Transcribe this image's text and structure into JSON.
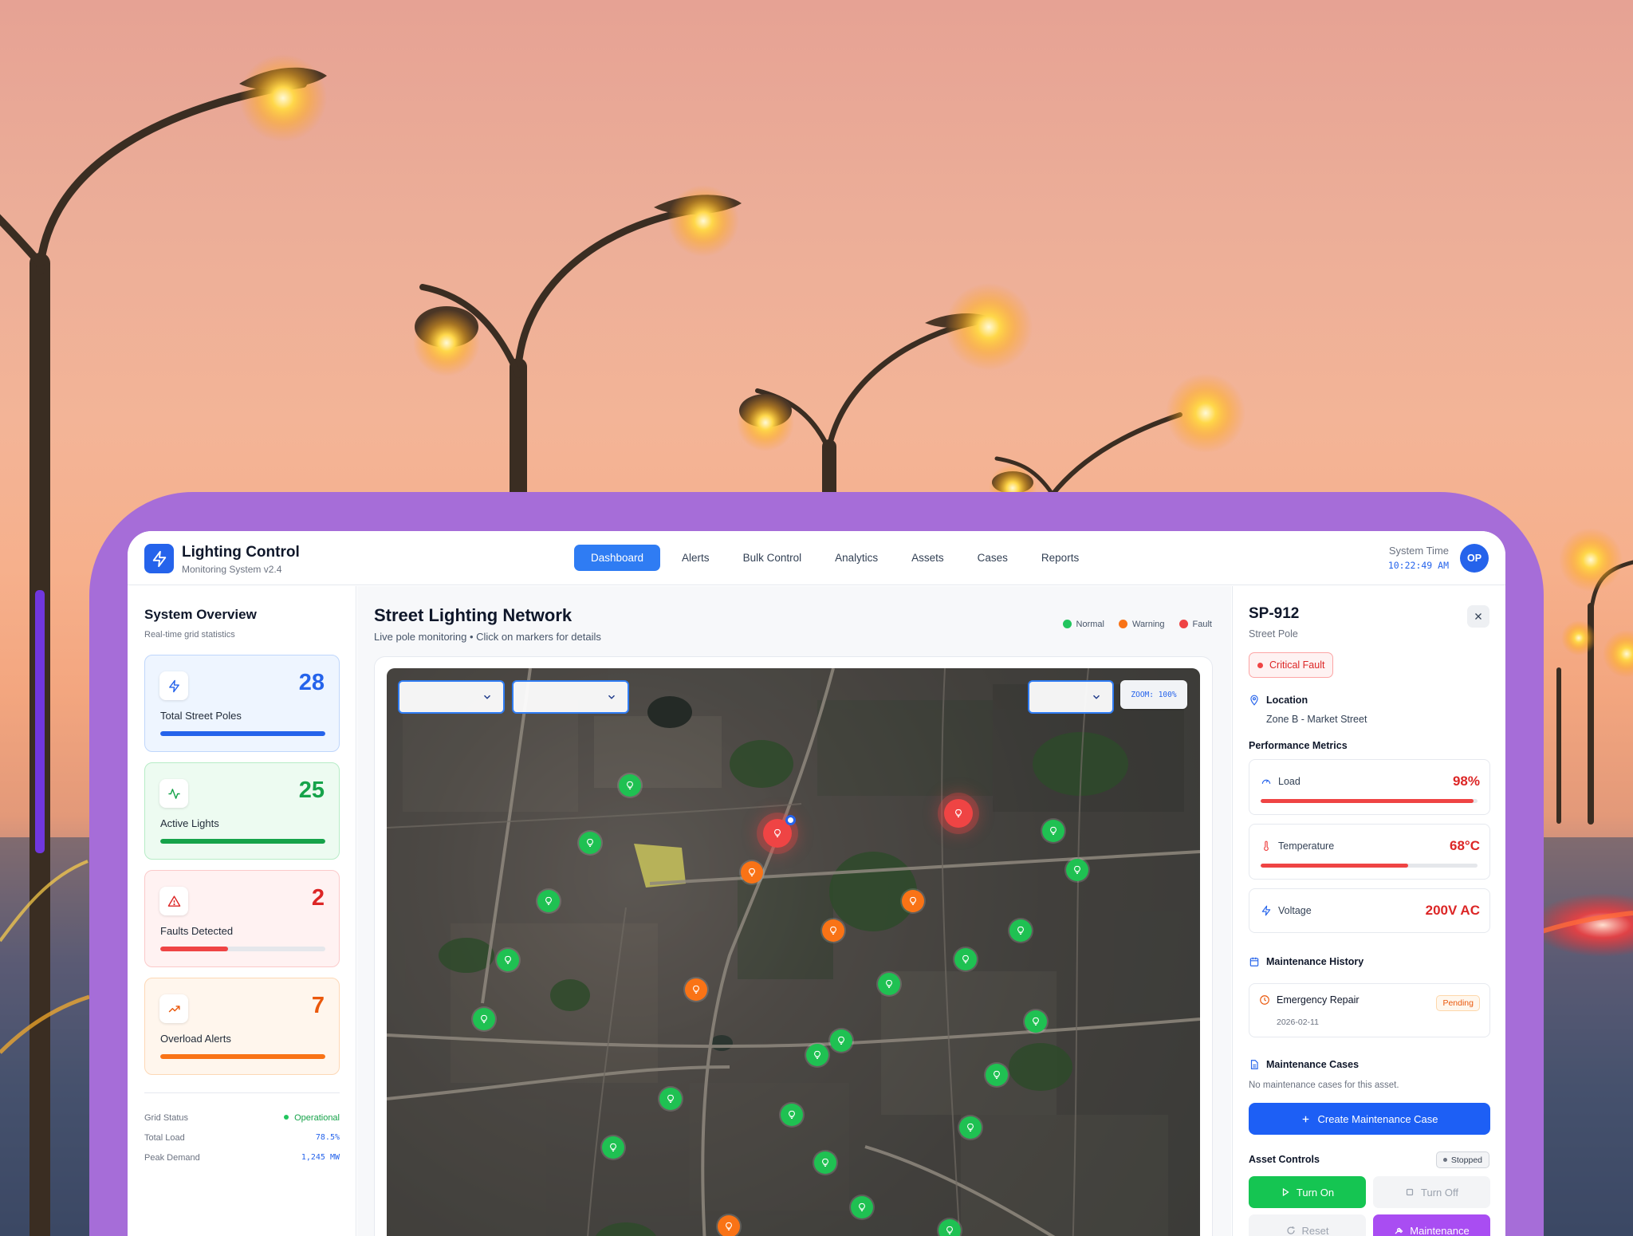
{
  "header": {
    "app_title": "Lighting Control",
    "app_subtitle": "Monitoring System v2.4",
    "nav": [
      "Dashboard",
      "Alerts",
      "Bulk Control",
      "Analytics",
      "Assets",
      "Cases",
      "Reports"
    ],
    "active_nav": "Dashboard",
    "system_time_label": "System Time",
    "system_time": "10:22:49 AM",
    "avatar_initials": "OP"
  },
  "overview": {
    "title": "System Overview",
    "subtitle": "Real-time grid statistics",
    "stats": [
      {
        "label": "Total Street Poles",
        "value": "28",
        "fill": 1.0,
        "color": "#2563eb",
        "icon": "zap-icon"
      },
      {
        "label": "Active Lights",
        "value": "25",
        "fill": 1.0,
        "color": "#16a34a",
        "icon": "activity-icon"
      },
      {
        "label": "Faults Detected",
        "value": "2",
        "fill": 0.31,
        "color": "#dc2626",
        "icon": "alert-triangle-icon"
      },
      {
        "label": "Overload Alerts",
        "value": "7",
        "fill": 1.0,
        "color": "#ea580c",
        "icon": "trending-up-icon"
      }
    ],
    "grid_status_label": "Grid Status",
    "grid_status_value": "Operational",
    "total_load_label": "Total Load",
    "total_load_value": "78.5%",
    "peak_demand_label": "Peak Demand",
    "peak_demand_value": "1,245 MW"
  },
  "network": {
    "title": "Street Lighting Network",
    "subtitle": "Live pole monitoring • Click on markers for details",
    "legend": {
      "normal": "Normal",
      "warning": "Warning",
      "fault": "Fault"
    },
    "zoom_label": "ZOOM: 100%",
    "colors": {
      "normal": "#1fc152",
      "warning": "#f97316",
      "fault": "#ef4444"
    }
  },
  "details": {
    "asset_id": "SP-912",
    "asset_type": "Street Pole",
    "status_badge": "Critical Fault",
    "location_heading": "Location",
    "location_value": "Zone B - Market Street",
    "metrics_heading": "Performance Metrics",
    "metrics": [
      {
        "label": "Load",
        "value": "98%",
        "fill": 0.98,
        "icon": "gauge-icon"
      },
      {
        "label": "Temperature",
        "value": "68°C",
        "fill": 0.68,
        "icon": "thermometer-icon"
      },
      {
        "label": "Voltage",
        "value": "200V AC",
        "icon": "zap-icon"
      }
    ],
    "history_heading": "Maintenance History",
    "history_item_title": "Emergency Repair",
    "history_item_date": "2026-02-11",
    "history_item_status": "Pending",
    "cases_heading": "Maintenance Cases",
    "cases_empty": "No maintenance cases for this asset.",
    "create_case_label": "Create Maintenance Case",
    "controls_heading": "Asset Controls",
    "controls_status": "Stopped",
    "turn_on_label": "Turn On",
    "turn_off_label": "Turn Off",
    "reset_label": "Reset",
    "maintenance_label": "Maintenance"
  }
}
